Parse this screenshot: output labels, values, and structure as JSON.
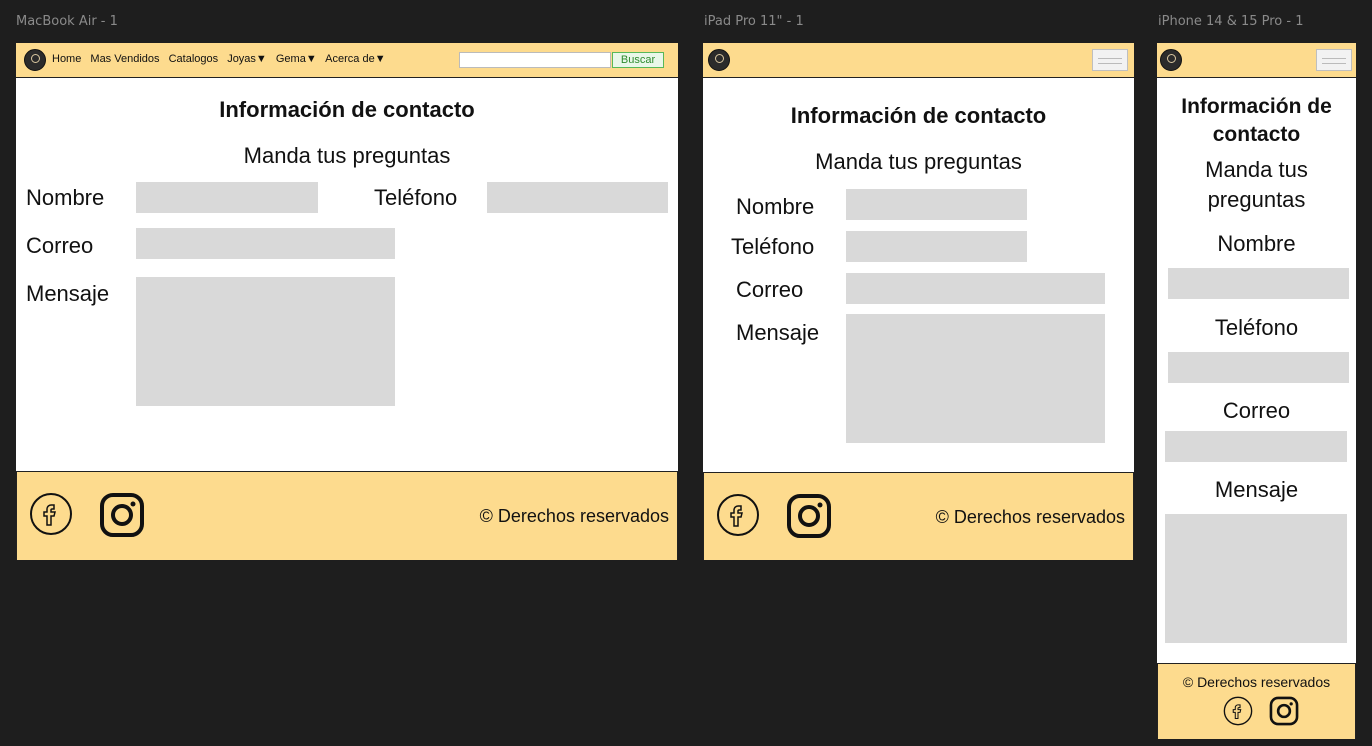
{
  "frames": {
    "desktop": {
      "label": "MacBook Air - 1",
      "nav": [
        "Home",
        "Mas Vendidos",
        "Catalogos",
        "Joyas▼",
        "Gema▼",
        "Acerca de▼"
      ],
      "search": {
        "placeholder": "",
        "button": "Buscar"
      },
      "title": "Información de contacto",
      "subtitle": "Manda tus preguntas",
      "labels": {
        "name": "Nombre",
        "phone": "Teléfono",
        "email": "Correo",
        "message": "Mensaje"
      },
      "footer": {
        "rights": "© Derechos reservados"
      }
    },
    "tablet": {
      "label": "iPad Pro 11\" - 1",
      "title": "Información de contacto",
      "subtitle": "Manda tus preguntas",
      "labels": {
        "name": "Nombre",
        "phone": "Teléfono",
        "email": "Correo",
        "message": "Mensaje"
      },
      "footer": {
        "rights": "© Derechos reservados"
      }
    },
    "mobile": {
      "label": "iPhone 14 & 15 Pro - 1",
      "title_line1": "Información de",
      "title_line2": "contacto",
      "subtitle_line1": "Manda tus",
      "subtitle_line2": "preguntas",
      "labels": {
        "name": "Nombre",
        "phone": "Teléfono",
        "email": "Correo",
        "message": "Mensaje"
      },
      "footer": {
        "rights": "© Derechos reservados"
      }
    }
  },
  "colors": {
    "header_bg": "#fddb8e",
    "field_bg": "#d9d9d9",
    "canvas_bg": "#1e1e1e",
    "search_btn": "#58b858"
  },
  "icons": [
    "facebook-icon",
    "instagram-icon",
    "logo-icon",
    "hamburger-menu-icon"
  ]
}
